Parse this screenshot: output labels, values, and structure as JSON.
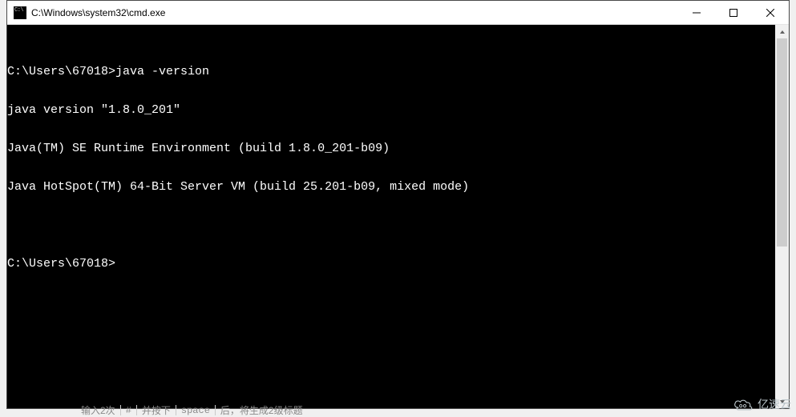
{
  "window": {
    "title": "C:\\Windows\\system32\\cmd.exe"
  },
  "terminal": {
    "prompt1": "C:\\Users\\67018>",
    "command1": "java -version",
    "output": [
      "java version \"1.8.0_201\"",
      "Java(TM) SE Runtime Environment (build 1.8.0_201-b09)",
      "Java HotSpot(TM) 64-Bit Server VM (build 25.201-b09, mixed mode)"
    ],
    "prompt2": "C:\\Users\\67018>"
  },
  "bottom_hints": {
    "seg1": "输入2次",
    "seg2": "#",
    "seg3": "并按下",
    "seg4": "space",
    "seg5": "后，将生成2级标题"
  },
  "watermark": {
    "text": "亿速云"
  }
}
